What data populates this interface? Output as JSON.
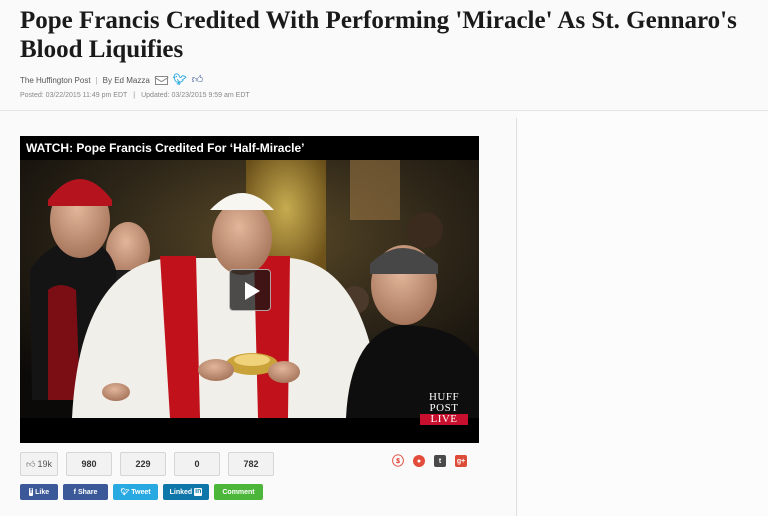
{
  "article": {
    "headline": "Pope Francis Credited With Performing 'Miracle' As St. Gennaro's Blood Liquifies",
    "source": "The Huffington Post",
    "author": "By Ed Mazza",
    "posted": "Posted: 03/22/2015 11:49 pm EDT",
    "updated": "Updated: 03/23/2015 9:59 am EDT"
  },
  "byline_icons": [
    "email-icon",
    "twitter-icon",
    "facebook-like-icon"
  ],
  "video": {
    "title": "WATCH: Pope Francis Credited For ‘Half-Miracle’",
    "logo_lines": [
      "HUFF",
      "POST",
      "LIVE"
    ],
    "logo_live_color": "#c8102e"
  },
  "share_counts": {
    "facebook_likes": "19k",
    "counts": [
      "980",
      "229",
      "0",
      "782"
    ]
  },
  "share_buttons": {
    "like": "Like",
    "share": "Share",
    "tweet": "Tweet",
    "linkedin_prefix": "Linked",
    "linkedin_suffix": "in",
    "comment": "Comment"
  },
  "social_icons": [
    "stumbleupon-icon",
    "reddit-icon",
    "tumblr-icon",
    "google-plus-icon"
  ],
  "colors": {
    "facebook": "#3b5998",
    "twitter": "#29a9e1",
    "linkedin": "#0e76a8",
    "comment": "#4cb63a",
    "google_plus": "#dd4b39"
  }
}
